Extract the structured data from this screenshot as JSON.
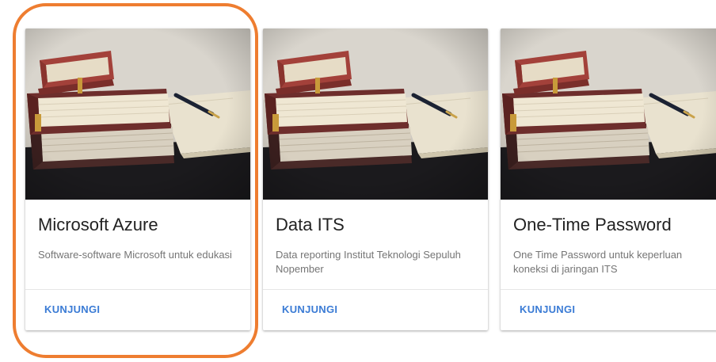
{
  "cards": [
    {
      "title": "Microsoft Azure",
      "description": "Software-software Microsoft untuk edukasi",
      "action_label": "KUNJUNGI",
      "image_icon": "books-photo"
    },
    {
      "title": "Data ITS",
      "description": "Data reporting Institut Teknologi Sepuluh Nopember",
      "action_label": "KUNJUNGI",
      "image_icon": "books-photo"
    },
    {
      "title": "One-Time Password",
      "description": "One Time Password untuk keperluan koneksi di jaringan ITS",
      "action_label": "KUNJUNGI",
      "image_icon": "books-photo"
    }
  ],
  "colors": {
    "accent_link": "#3a7bd5",
    "highlight": "#ee7d30",
    "title_text": "#222222",
    "description_text": "#757575"
  }
}
